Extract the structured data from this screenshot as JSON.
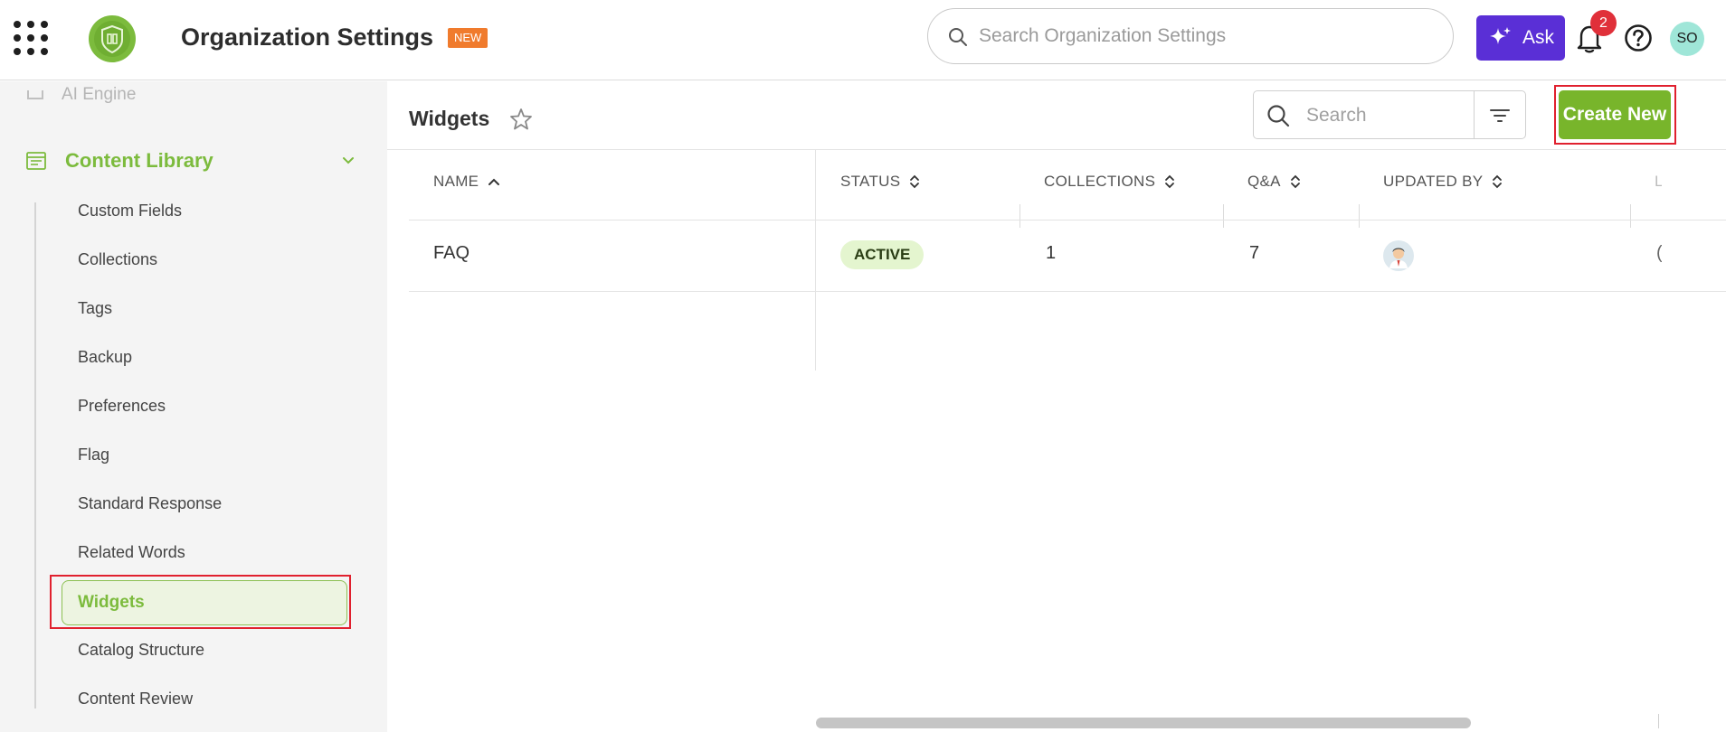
{
  "header": {
    "title": "Organization Settings",
    "new_badge": "NEW",
    "search_placeholder": "Search Organization Settings",
    "ask_label": "Ask",
    "notification_count": "2",
    "user_initials": "SO"
  },
  "sidebar": {
    "cut_off_item": "AI Engine",
    "section_label": "Content Library",
    "items": [
      {
        "label": "Custom Fields"
      },
      {
        "label": "Collections"
      },
      {
        "label": "Tags"
      },
      {
        "label": "Backup"
      },
      {
        "label": "Preferences"
      },
      {
        "label": "Flag"
      },
      {
        "label": "Standard Response"
      },
      {
        "label": "Related Words"
      },
      {
        "label": "Widgets",
        "active": true
      },
      {
        "label": "Catalog Structure"
      },
      {
        "label": "Content Review"
      }
    ]
  },
  "main": {
    "title": "Widgets",
    "search_placeholder": "Search",
    "create_label": "Create New",
    "table": {
      "columns": [
        "NAME",
        "STATUS",
        "COLLECTIONS",
        "Q&A",
        "UPDATED BY",
        "L"
      ],
      "rows": [
        {
          "name": "FAQ",
          "status": "ACTIVE",
          "collections": "1",
          "qa": "7",
          "updated_by": "user-avatar",
          "last": "("
        }
      ]
    }
  },
  "colors": {
    "accent_green": "#78b52b",
    "ask_purple": "#5a2fd6",
    "badge_orange": "#f07b2d",
    "highlight_red": "#e0202e"
  }
}
